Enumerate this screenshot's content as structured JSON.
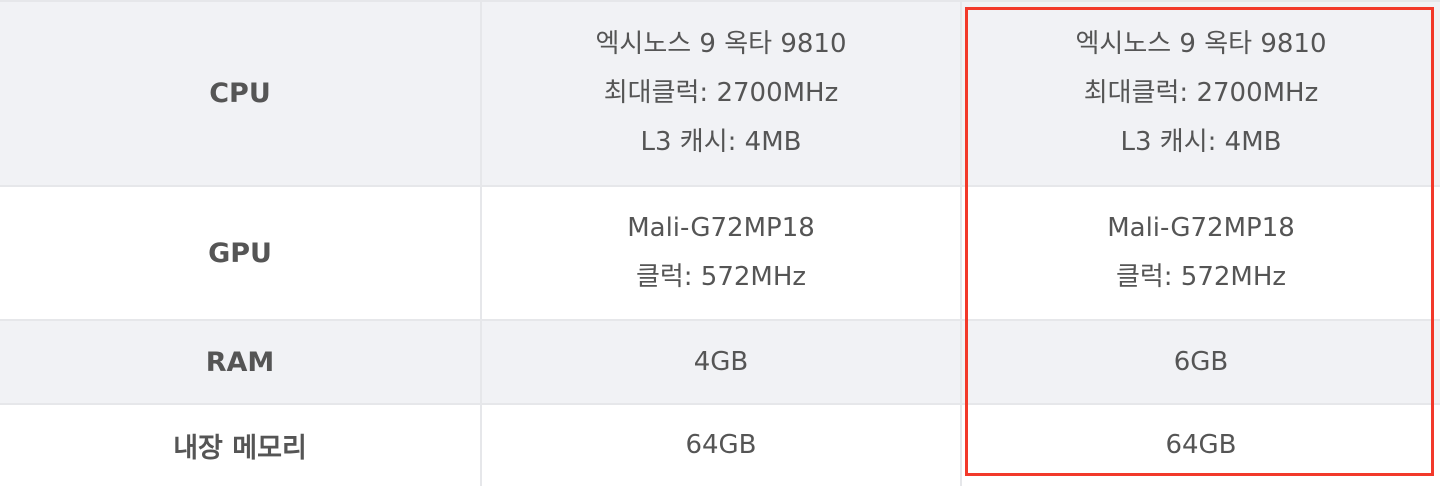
{
  "table": {
    "rows": [
      {
        "label": "CPU",
        "col1": [
          "엑시노스 9 옥타 9810",
          "최대클럭: 2700MHz",
          "L3 캐시: 4MB"
        ],
        "col2": [
          "엑시노스 9 옥타 9810",
          "최대클럭: 2700MHz",
          "L3 캐시: 4MB"
        ]
      },
      {
        "label": "GPU",
        "col1": [
          "Mali-G72MP18",
          "클럭: 572MHz"
        ],
        "col2": [
          "Mali-G72MP18",
          "클럭: 572MHz"
        ]
      },
      {
        "label": "RAM",
        "col1": [
          "4GB"
        ],
        "col2": [
          "6GB"
        ]
      },
      {
        "label": "내장 메모리",
        "col1": [
          "64GB"
        ],
        "col2": [
          "64GB"
        ]
      }
    ]
  },
  "highlight_color": "#f2392a"
}
